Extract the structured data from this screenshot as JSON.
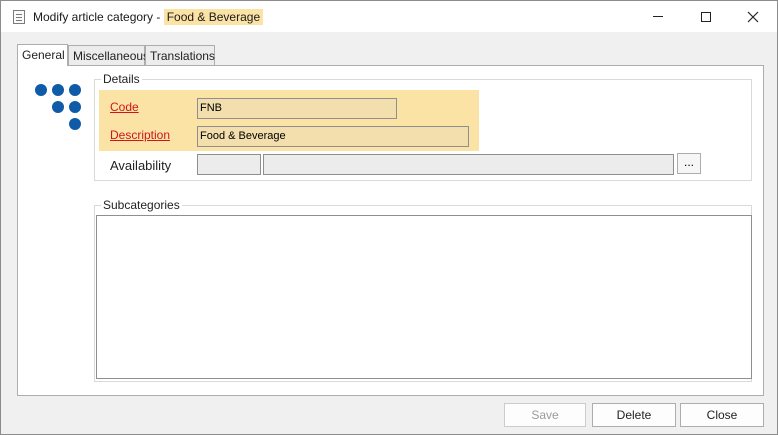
{
  "window": {
    "title_prefix": "Modify article category - ",
    "title_highlight": "Food & Beverage"
  },
  "tabs": [
    {
      "label": "General",
      "active": true
    },
    {
      "label": "Miscellaneous",
      "active": false
    },
    {
      "label": "Translations",
      "active": false
    }
  ],
  "details": {
    "group_title": "Details",
    "code_label": "Code",
    "code_value": "FNB",
    "description_label": "Description",
    "description_value": "Food & Beverage",
    "availability_label": "Availability",
    "availability_value_1": "",
    "availability_value_2": "",
    "ellipsis_label": "..."
  },
  "subcategories": {
    "group_title": "Subcategories"
  },
  "buttons": {
    "save": "Save",
    "delete": "Delete",
    "close": "Close"
  },
  "colors": {
    "required_highlight": "#fbe3a6",
    "required_label": "#d0141c",
    "logo_blue": "#0f5ba7"
  }
}
